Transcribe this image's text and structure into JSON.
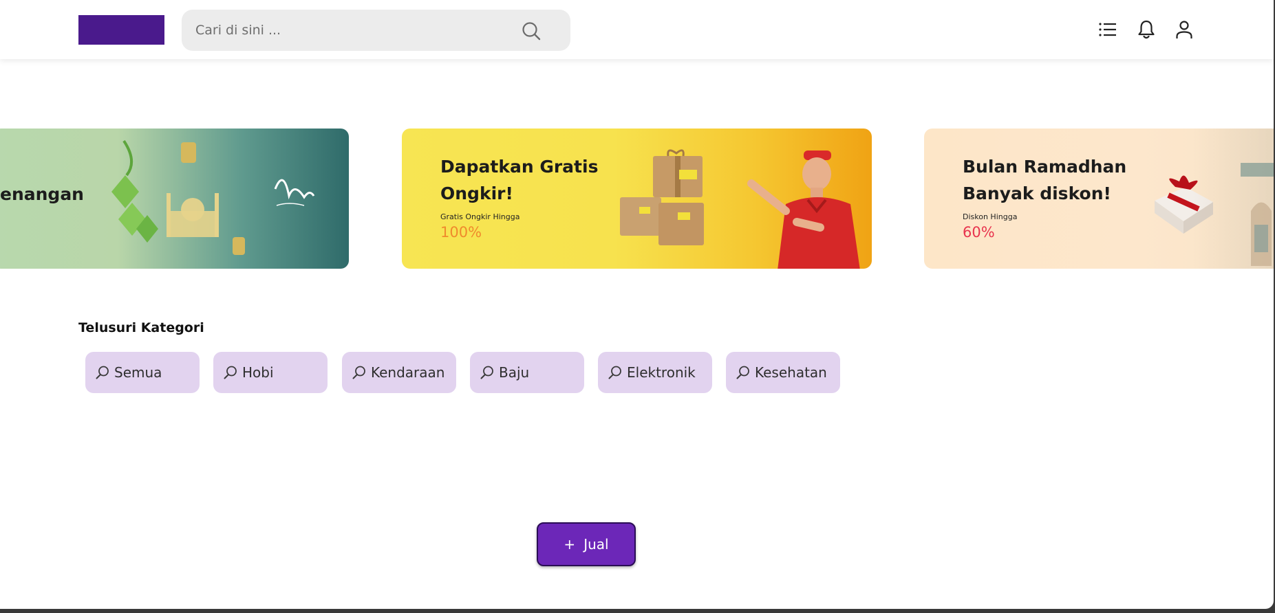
{
  "header": {
    "search_placeholder": "Cari di sini ...",
    "icons": [
      "search-icon",
      "list-icon",
      "bell-icon",
      "user-icon"
    ]
  },
  "banners": [
    {
      "title": "enangan"
    },
    {
      "title_line1": "Dapatkan Gratis",
      "title_line2": "Ongkir!",
      "sub": "Gratis Ongkir Hingga",
      "value": "100%",
      "value_color": "#f08a2c"
    },
    {
      "title_line1": "Bulan Ramadhan",
      "title_line2": "Banyak diskon!",
      "sub": "Diskon Hingga",
      "value": "60%",
      "value_color": "#e8344e"
    }
  ],
  "categories": {
    "title": "Telusuri Kategori",
    "items": [
      {
        "label": "Semua"
      },
      {
        "label": "Hobi"
      },
      {
        "label": "Kendaraan"
      },
      {
        "label": "Baju"
      },
      {
        "label": "Elektronik"
      },
      {
        "label": "Kesehatan"
      }
    ]
  },
  "sell_button": {
    "plus": "+",
    "label": "Jual"
  },
  "colors": {
    "brand": "#4a1a8c",
    "accent": "#6c27b8",
    "chip_bg": "#e2d3ef"
  }
}
